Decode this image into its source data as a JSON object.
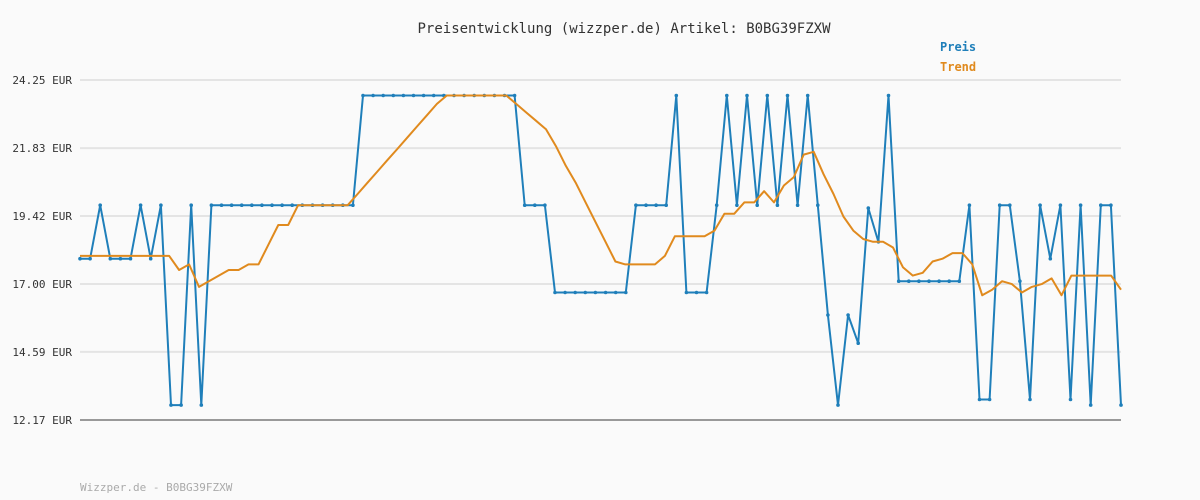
{
  "chart_data": {
    "type": "line",
    "title": "Preisentwicklung (wizzper.de) Artikel: B0BG39FZXW",
    "xlabel": "",
    "ylabel": "",
    "ylim": [
      12.17,
      24.25
    ],
    "yticks": [
      "24.25 EUR",
      "21.83 EUR",
      "19.42 EUR",
      "17.00 EUR",
      "14.59 EUR",
      "12.17 EUR"
    ],
    "ytick_values": [
      24.25,
      21.83,
      19.42,
      17.0,
      14.59,
      12.17
    ],
    "grid": true,
    "legend_position": "top-right",
    "series": [
      {
        "name": "Preis",
        "color": "#1f7fba",
        "values": [
          17.9,
          17.9,
          19.8,
          17.9,
          17.9,
          17.9,
          19.8,
          17.9,
          19.8,
          12.7,
          12.7,
          19.8,
          12.7,
          19.8,
          19.8,
          19.8,
          19.8,
          19.8,
          19.8,
          19.8,
          19.8,
          19.8,
          19.8,
          19.8,
          19.8,
          19.8,
          19.8,
          19.8,
          23.7,
          23.7,
          23.7,
          23.7,
          23.7,
          23.7,
          23.7,
          23.7,
          23.7,
          23.7,
          23.7,
          23.7,
          23.7,
          23.7,
          23.7,
          23.7,
          19.8,
          19.8,
          19.8,
          16.7,
          16.7,
          16.7,
          16.7,
          16.7,
          16.7,
          16.7,
          16.7,
          19.8,
          19.8,
          19.8,
          19.8,
          23.7,
          16.7,
          16.7,
          16.7,
          19.8,
          23.7,
          19.8,
          23.7,
          19.8,
          23.7,
          19.8,
          23.7,
          19.8,
          23.7,
          19.8,
          15.9,
          12.7,
          15.9,
          14.9,
          19.7,
          18.5,
          23.7,
          17.1,
          17.1,
          17.1,
          17.1,
          17.1,
          17.1,
          17.1,
          19.8,
          12.9,
          12.9,
          19.8,
          19.8,
          17.1,
          12.9,
          19.8,
          17.9,
          19.8,
          12.9,
          19.8,
          12.7,
          19.8,
          19.8,
          12.7
        ]
      },
      {
        "name": "Trend",
        "color": "#e08a1e",
        "values": [
          18.0,
          18.0,
          18.0,
          18.0,
          18.0,
          18.0,
          18.0,
          18.0,
          18.0,
          18.0,
          17.5,
          17.7,
          16.9,
          17.1,
          17.3,
          17.5,
          17.5,
          17.7,
          17.7,
          18.4,
          19.1,
          19.1,
          19.8,
          19.8,
          19.8,
          19.8,
          19.8,
          19.8,
          20.2,
          20.6,
          21.0,
          21.4,
          21.8,
          22.2,
          22.6,
          23.0,
          23.4,
          23.7,
          23.7,
          23.7,
          23.7,
          23.7,
          23.7,
          23.7,
          23.4,
          23.1,
          22.8,
          22.5,
          21.9,
          21.2,
          20.6,
          19.9,
          19.2,
          18.5,
          17.8,
          17.7,
          17.7,
          17.7,
          17.7,
          18.0,
          18.7,
          18.7,
          18.7,
          18.7,
          18.9,
          19.5,
          19.5,
          19.9,
          19.9,
          20.3,
          19.9,
          20.5,
          20.8,
          21.6,
          21.7,
          20.9,
          20.2,
          19.4,
          18.9,
          18.6,
          18.5,
          18.5,
          18.3,
          17.6,
          17.3,
          17.4,
          17.8,
          17.9,
          18.1,
          18.1,
          17.7,
          16.6,
          16.8,
          17.1,
          17.0,
          16.7,
          16.9,
          17.0,
          17.2,
          16.6,
          17.3,
          17.3,
          17.3,
          17.3,
          17.3,
          16.8
        ]
      }
    ]
  },
  "footer": "Wizzper.de - B0BG39FZXW"
}
